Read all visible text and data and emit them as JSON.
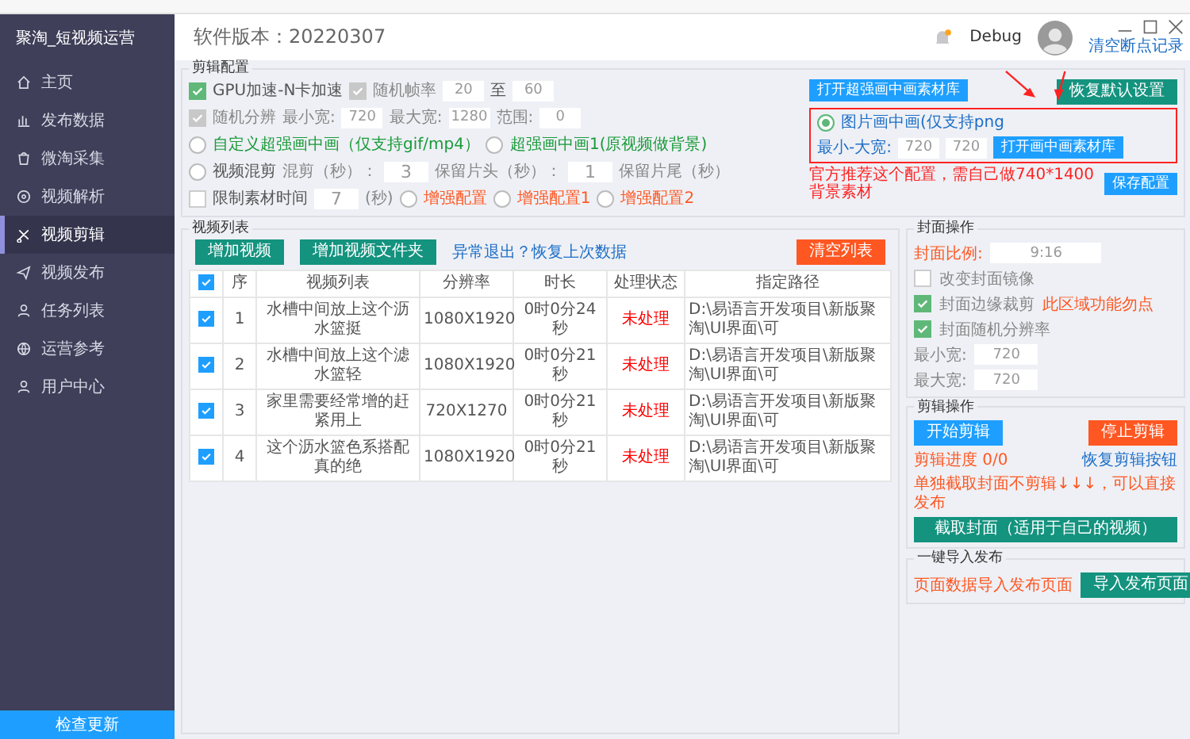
{
  "header": {
    "app_title": "聚淘_短视频运营",
    "version": "软件版本：20220307",
    "notification": true,
    "debug": "Debug",
    "clear_link": "清空断点记录"
  },
  "sidebar": {
    "items": [
      {
        "label": "主页",
        "selected": false
      },
      {
        "label": "发布数据",
        "selected": false
      },
      {
        "label": "微淘采集",
        "selected": false
      },
      {
        "label": "视频解析",
        "selected": false
      },
      {
        "label": "视频剪辑",
        "selected": true
      },
      {
        "label": "视频发布",
        "selected": false
      },
      {
        "label": "任务列表",
        "selected": false
      },
      {
        "label": "运营参考",
        "selected": false
      },
      {
        "label": "用户中心",
        "selected": false
      }
    ],
    "update_button": "检查更新"
  },
  "config": {
    "title": "剪辑配置",
    "gpu": {
      "label": "GPU加速-N卡加速",
      "checked": true
    },
    "random_fps": {
      "label": "随机帧率",
      "checked": true,
      "disabled": true,
      "from": "20",
      "to_label": "至",
      "to": "60"
    },
    "random_res": {
      "label": "随机分辨",
      "checked": true,
      "disabled": true,
      "min_label": "最小宽:",
      "min": "720",
      "max_label": "最大宽:",
      "max": "1280",
      "range_label": "范围:",
      "range": "0"
    },
    "custom_pip": {
      "label": "自定义超强画中画（仅支持gif/mp4）",
      "selected": false
    },
    "super_pip": {
      "label": "超强画中画1(原视频做背景)",
      "selected": false
    },
    "open_super_button": "打开超强画中画素材库",
    "image_pip": {
      "label": "图片画中画(仅支持png",
      "selected": true,
      "size_label": "最小-大宽:",
      "min": "720",
      "max": "720",
      "button": "打开画中画素材库"
    },
    "mix": {
      "label": "视频混剪",
      "selected": false,
      "cut_label": "混剪（秒）：",
      "cut": "3",
      "head_label": "保留片头（秒）：",
      "head": "1",
      "tail_label": "保留片尾（秒）"
    },
    "limit": {
      "label": "限制素材时间",
      "checked": false,
      "value": "7",
      "unit": "(秒)"
    },
    "enhance": [
      {
        "label": "增强配置",
        "selected": false
      },
      {
        "label": "增强配置1",
        "selected": false
      },
      {
        "label": "增强配置2",
        "selected": false
      }
    ],
    "reset_button": "恢复默认设置",
    "annotation": "官方推荐这个配置，需自己做740*1400背景素材",
    "save_button": "保存配置"
  },
  "video_list": {
    "title": "视频列表",
    "add_button": "增加视频",
    "add_folder_button": "增加视频文件夹",
    "restore_link": "异常退出？恢复上次数据",
    "clear_button": "清空列表",
    "header_checked": true,
    "columns": [
      "序",
      "视频列表",
      "分辨率",
      "时长",
      "处理状态",
      "指定路径"
    ],
    "rows": [
      {
        "checked": true,
        "index": "1",
        "name": "水槽中间放上这个沥水篮挺",
        "resolution": "1080X1920",
        "duration": "0时0分24秒",
        "status": "未处理",
        "path": "D:\\易语言开发项目\\新版聚淘\\UI界面\\可"
      },
      {
        "checked": true,
        "index": "2",
        "name": "水槽中间放上这个滤水篮轻",
        "resolution": "1080X1920",
        "duration": "0时0分21秒",
        "status": "未处理",
        "path": "D:\\易语言开发项目\\新版聚淘\\UI界面\\可"
      },
      {
        "checked": true,
        "index": "3",
        "name": "家里需要经常增的赶紧用上",
        "resolution": "720X1270",
        "duration": "0时0分21秒",
        "status": "未处理",
        "path": "D:\\易语言开发项目\\新版聚淘\\UI界面\\可"
      },
      {
        "checked": true,
        "index": "4",
        "name": "这个沥水篮色系搭配真的绝",
        "resolution": "1080X1920",
        "duration": "0时0分21秒",
        "status": "未处理",
        "path": "D:\\易语言开发项目\\新版聚淘\\UI界面\\可"
      }
    ]
  },
  "cover": {
    "title": "封面操作",
    "ratio_label": "封面比例:",
    "ratio": "9:16",
    "mirror": {
      "label": "改变封面镜像",
      "checked": false
    },
    "edge": {
      "label": "封面边缘裁剪",
      "checked": true
    },
    "warning": "此区域功能勿点",
    "random_res": {
      "label": "封面随机分辨率",
      "checked": true
    },
    "min_label": "最小宽:",
    "min": "720",
    "max_label": "最大宽:",
    "max": "720"
  },
  "edit_ops": {
    "title": "剪辑操作",
    "start_button": "开始剪辑",
    "stop_button": "停止剪辑",
    "progress": "剪辑进度 0/0",
    "restore_link": "恢复剪辑按钮",
    "note": "单独截取封面不剪辑↓↓↓，可以直接发布",
    "capture_button": "截取封面（适用于自己的视频）"
  },
  "publish": {
    "title": "一键导入发布",
    "note": "页面数据导入发布页面",
    "import_button": "导入发布页面"
  }
}
